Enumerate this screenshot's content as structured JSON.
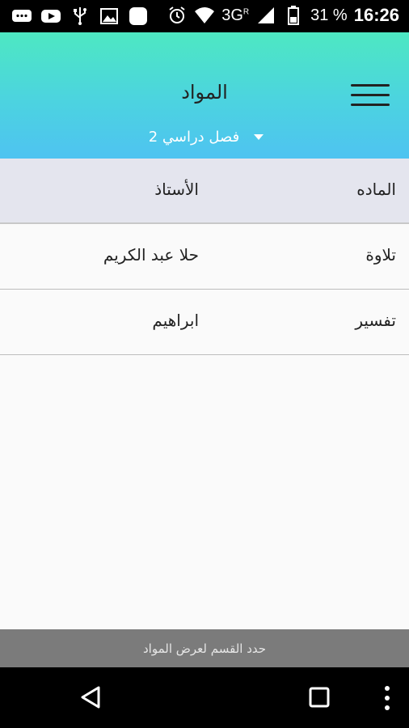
{
  "status_bar": {
    "network": "3G",
    "network_sup": "R",
    "battery": "31 %",
    "time": "16:26",
    "icons": [
      "messaging-icon",
      "youtube-icon",
      "usb-icon",
      "image-icon",
      "square-app-icon",
      "alarm-icon",
      "wifi-icon",
      "signal-icon",
      "battery-icon"
    ]
  },
  "header": {
    "title": "المواد",
    "semester_label": "فصل دراسي 2",
    "menu_icon": "hamburger-menu-icon"
  },
  "table": {
    "columns": {
      "subject": "الماده",
      "teacher": "الأستاذ"
    },
    "rows": [
      {
        "subject": "تلاوة",
        "teacher": "حلا عبد الكريم"
      },
      {
        "subject": "تفسير",
        "teacher": "ابراهيم"
      }
    ]
  },
  "footer_hint": "حدد القسم لعرض المواد",
  "nav": {
    "icons": [
      "back-icon",
      "recent-apps-icon",
      "more-options-icon"
    ]
  },
  "colors": {
    "header_top": "#4de8c2",
    "header_bottom": "#4ec3f1",
    "table_header_bg": "#e4e5ee",
    "hint_bg": "#7b7b7b"
  }
}
